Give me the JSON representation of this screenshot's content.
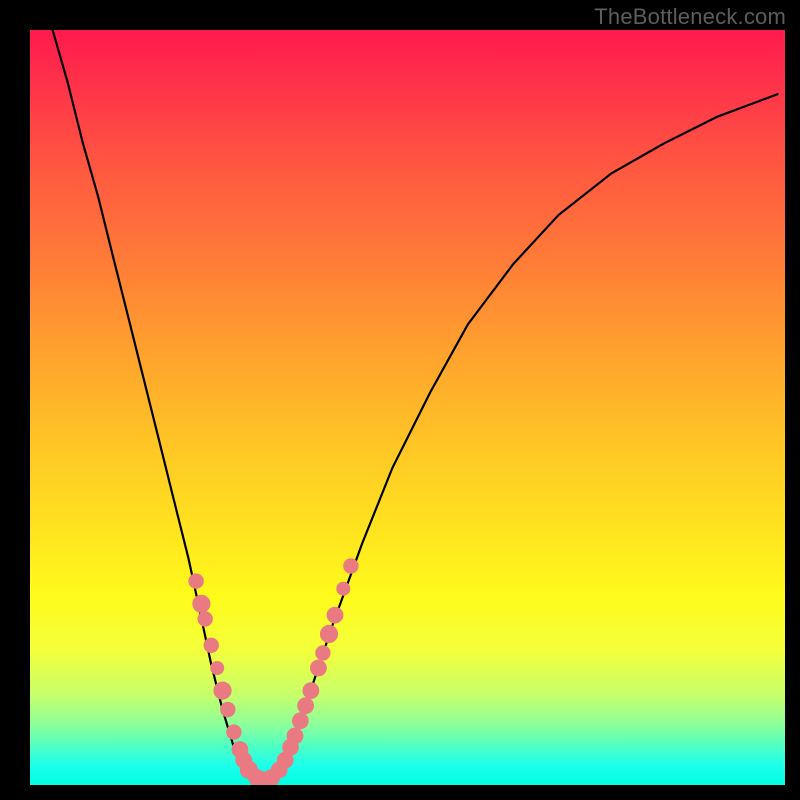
{
  "watermark": "TheBottleneck.com",
  "chart_data": {
    "type": "line",
    "title": "",
    "xlabel": "",
    "ylabel": "",
    "xlim": [
      0,
      100
    ],
    "ylim": [
      0,
      100
    ],
    "curve": {
      "name": "bottleneck-curve",
      "points": [
        {
          "x": 3.0,
          "y": 100.0
        },
        {
          "x": 5.0,
          "y": 93.0
        },
        {
          "x": 7.0,
          "y": 85.0
        },
        {
          "x": 9.0,
          "y": 78.0
        },
        {
          "x": 11.0,
          "y": 70.0
        },
        {
          "x": 13.0,
          "y": 62.0
        },
        {
          "x": 15.0,
          "y": 54.0
        },
        {
          "x": 17.0,
          "y": 46.0
        },
        {
          "x": 19.0,
          "y": 38.0
        },
        {
          "x": 21.0,
          "y": 30.0
        },
        {
          "x": 22.5,
          "y": 23.0
        },
        {
          "x": 24.0,
          "y": 16.0
        },
        {
          "x": 25.5,
          "y": 10.0
        },
        {
          "x": 27.0,
          "y": 5.0
        },
        {
          "x": 28.5,
          "y": 2.0
        },
        {
          "x": 30.0,
          "y": 0.5
        },
        {
          "x": 31.5,
          "y": 0.3
        },
        {
          "x": 33.0,
          "y": 1.5
        },
        {
          "x": 35.0,
          "y": 6.0
        },
        {
          "x": 37.0,
          "y": 12.0
        },
        {
          "x": 40.0,
          "y": 21.0
        },
        {
          "x": 44.0,
          "y": 32.0
        },
        {
          "x": 48.0,
          "y": 42.0
        },
        {
          "x": 53.0,
          "y": 52.0
        },
        {
          "x": 58.0,
          "y": 61.0
        },
        {
          "x": 64.0,
          "y": 69.0
        },
        {
          "x": 70.0,
          "y": 75.5
        },
        {
          "x": 77.0,
          "y": 81.0
        },
        {
          "x": 84.0,
          "y": 85.0
        },
        {
          "x": 91.0,
          "y": 88.5
        },
        {
          "x": 99.0,
          "y": 91.5
        }
      ]
    },
    "markers": {
      "name": "highlighted-points",
      "color": "#e97a82",
      "points": [
        {
          "x": 22.0,
          "y": 27.0,
          "r": 1.1
        },
        {
          "x": 22.7,
          "y": 24.0,
          "r": 1.3
        },
        {
          "x": 23.2,
          "y": 22.0,
          "r": 1.1
        },
        {
          "x": 24.0,
          "y": 18.5,
          "r": 1.1
        },
        {
          "x": 24.8,
          "y": 15.5,
          "r": 1.0
        },
        {
          "x": 25.5,
          "y": 12.5,
          "r": 1.3
        },
        {
          "x": 26.2,
          "y": 10.0,
          "r": 1.1
        },
        {
          "x": 27.0,
          "y": 7.0,
          "r": 1.1
        },
        {
          "x": 27.8,
          "y": 4.7,
          "r": 1.2
        },
        {
          "x": 28.3,
          "y": 3.3,
          "r": 1.2
        },
        {
          "x": 29.0,
          "y": 2.0,
          "r": 1.3
        },
        {
          "x": 30.0,
          "y": 1.0,
          "r": 1.2
        },
        {
          "x": 31.0,
          "y": 0.7,
          "r": 1.2
        },
        {
          "x": 32.0,
          "y": 1.0,
          "r": 1.2
        },
        {
          "x": 33.0,
          "y": 2.0,
          "r": 1.2
        },
        {
          "x": 33.8,
          "y": 3.3,
          "r": 1.2
        },
        {
          "x": 34.5,
          "y": 5.0,
          "r": 1.2
        },
        {
          "x": 35.1,
          "y": 6.5,
          "r": 1.2
        },
        {
          "x": 35.8,
          "y": 8.5,
          "r": 1.2
        },
        {
          "x": 36.5,
          "y": 10.5,
          "r": 1.2
        },
        {
          "x": 37.2,
          "y": 12.5,
          "r": 1.2
        },
        {
          "x": 38.2,
          "y": 15.5,
          "r": 1.2
        },
        {
          "x": 38.8,
          "y": 17.5,
          "r": 1.1
        },
        {
          "x": 39.6,
          "y": 20.0,
          "r": 1.3
        },
        {
          "x": 40.4,
          "y": 22.5,
          "r": 1.2
        },
        {
          "x": 41.5,
          "y": 26.0,
          "r": 1.0
        },
        {
          "x": 42.5,
          "y": 29.0,
          "r": 1.1
        }
      ]
    }
  }
}
